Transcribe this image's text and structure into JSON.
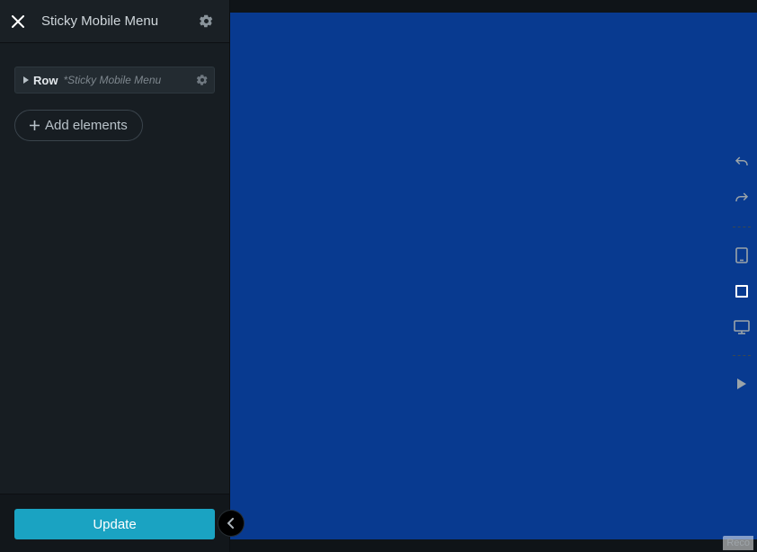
{
  "header": {
    "title": "Sticky Mobile Menu"
  },
  "tree": {
    "row_label": "Row",
    "row_sublabel": "*Sticky Mobile Menu"
  },
  "buttons": {
    "add_elements": "Add elements",
    "update": "Update"
  },
  "watermark": "Reco"
}
